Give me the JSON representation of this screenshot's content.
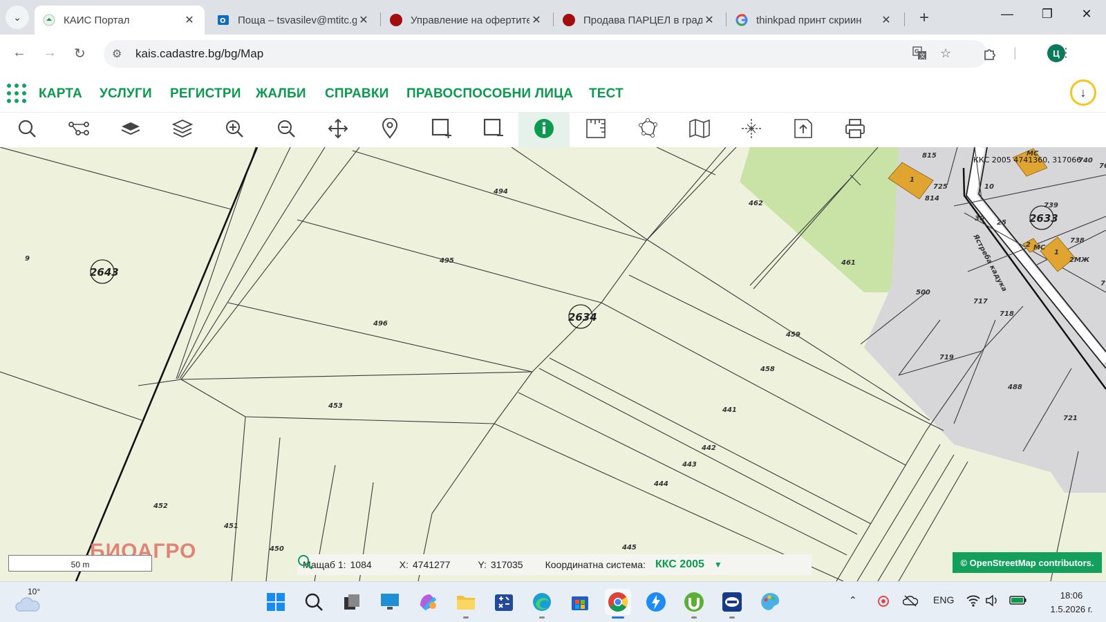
{
  "browser": {
    "tabs": [
      {
        "title": "КАИС Портал",
        "icon": "kais-icon",
        "active": true
      },
      {
        "title": "Поща – tsvasilev@mtitc.government.bg",
        "icon": "outlook-icon",
        "active": false
      },
      {
        "title": "Управление на офертите",
        "icon": "red-dot-icon",
        "active": false
      },
      {
        "title": "Продава ПАРЦЕЛ в град",
        "icon": "red-dot-icon",
        "active": false
      },
      {
        "title": "thinkpad принт скриин",
        "icon": "google-icon",
        "active": false
      }
    ],
    "new_tab": "+",
    "url": "kais.cadastre.bg/bg/Map",
    "profile_initial": "Ц"
  },
  "app_menu": {
    "items": [
      "КАРТА",
      "УСЛУГИ",
      "РЕГИСТРИ",
      "ЖАЛБИ",
      "СПРАВКИ",
      "ПРАВОСПОСОБНИ ЛИЦА",
      "ТЕСТ"
    ]
  },
  "map_tools": [
    "search-icon",
    "route-icon",
    "base-layer-icon",
    "layers-icon",
    "zoom-in-icon",
    "zoom-out-icon",
    "pan-icon",
    "location-pin-icon",
    "select-add-icon",
    "select-remove-icon",
    "info-icon",
    "measure-icon",
    "polygon-icon",
    "map-book-icon",
    "coordinates-icon",
    "export-icon",
    "print-icon"
  ],
  "active_tool": "info-icon",
  "map": {
    "districts": [
      "2643",
      "2634",
      "2633"
    ],
    "parcels": [
      "9",
      "494",
      "495",
      "496",
      "453",
      "452",
      "451",
      "450",
      "462",
      "461",
      "459",
      "458",
      "441",
      "442",
      "443",
      "444",
      "445",
      "500",
      "717",
      "718",
      "719",
      "488",
      "721",
      "814",
      "815",
      "739",
      "738",
      "725",
      "30",
      "10",
      "25",
      "1",
      "1",
      "2",
      "2МЖ",
      "МС",
      "МС",
      "740",
      "76",
      "7"
    ],
    "street_label": "Ястреба кадука",
    "crs_label": "ККС 2005 4741360, 317066",
    "watermark": "БИОАГРО",
    "scale_bar": "50 m",
    "attribution": "© OpenStreetMap contributors."
  },
  "status": {
    "scale_label": "Мащаб 1:",
    "scale_value": "1084",
    "x_label": "X:",
    "x_value": "4741277",
    "y_label": "Y:",
    "y_value": "317035",
    "crs_label": "Координатна система:",
    "crs_value": "ККС 2005"
  },
  "taskbar": {
    "temperature": "10°",
    "language": "ENG",
    "time": "18:06",
    "date": "1.5.2026 г."
  },
  "colors": {
    "accent": "#0a9b4f",
    "map_bg": "#eef1dc",
    "green_area": "#c8e2a4",
    "urban_area": "#d9d9dc",
    "building": "#e0a531"
  }
}
